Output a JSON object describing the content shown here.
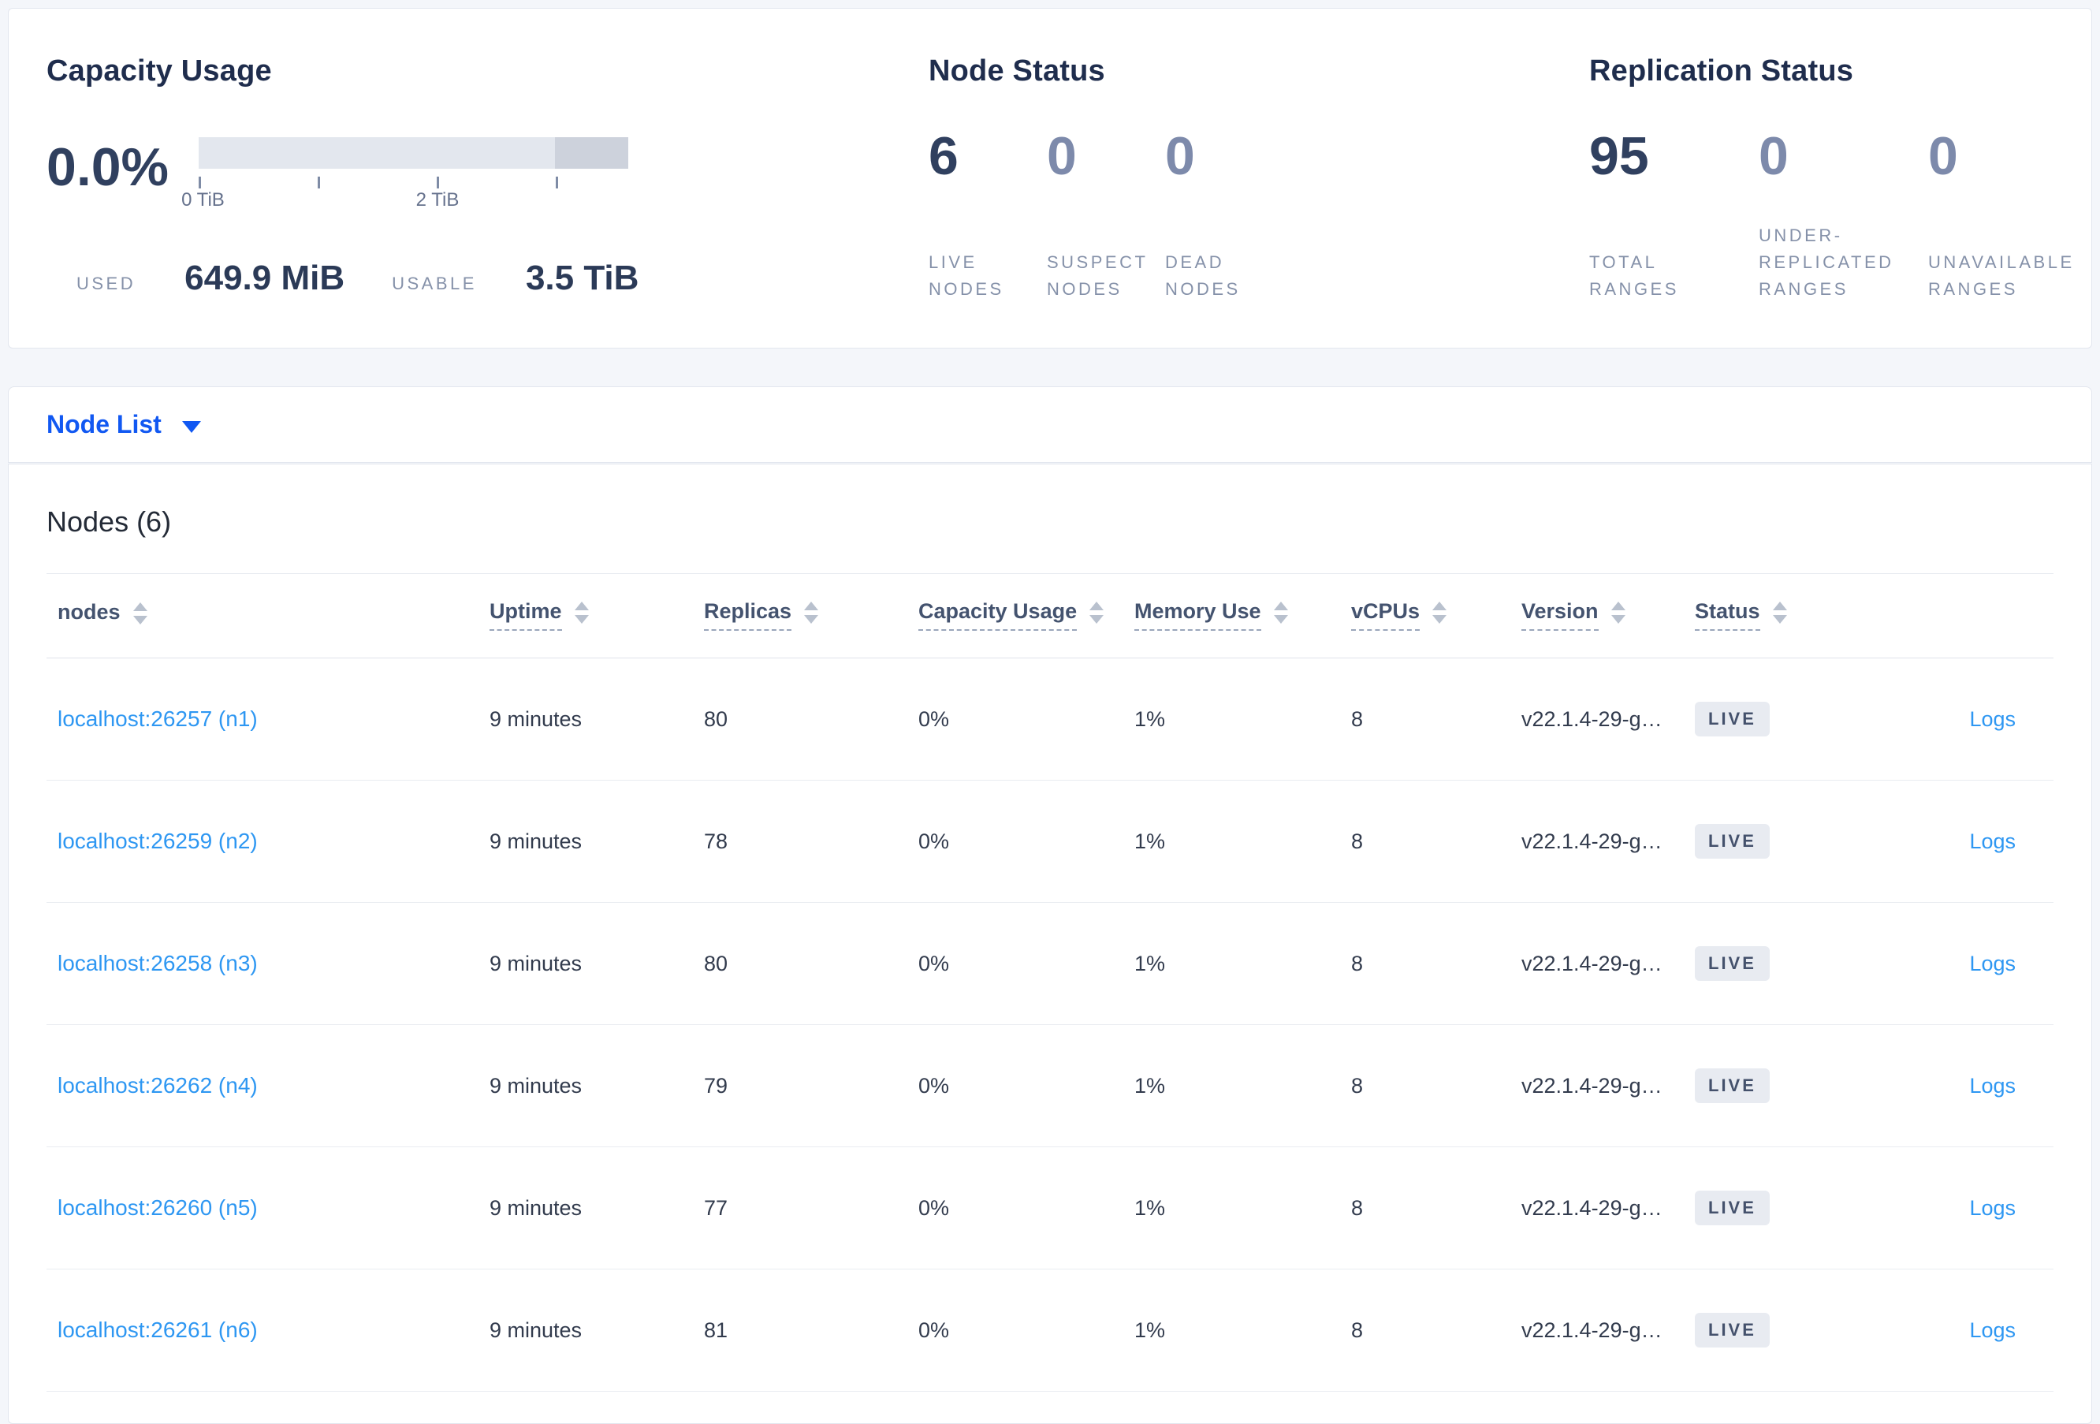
{
  "colors": {
    "accent_blue": "#1158f2",
    "link_blue": "#2e97f2",
    "page_background": "#f4f6fa",
    "badge_background": "#e8ebf1",
    "badge_text": "#44516c",
    "bar_light": "#e3e7ee",
    "bar_dark": "#cdd2dc"
  },
  "overview": {
    "capacity": {
      "title": "Capacity Usage",
      "percent": "0.0%",
      "tick_labels": [
        "0 TiB",
        "2 TiB"
      ],
      "used_label": "USED",
      "used_value": "649.9 MiB",
      "usable_label": "USABLE",
      "usable_value": "3.5 TiB"
    },
    "node_status": {
      "title": "Node Status",
      "stats": [
        {
          "value": "6",
          "label": "LIVE NODES"
        },
        {
          "value": "0",
          "label": "SUSPECT NODES"
        },
        {
          "value": "0",
          "label": "DEAD NODES"
        }
      ]
    },
    "replication": {
      "title": "Replication Status",
      "stats": [
        {
          "value": "95",
          "label": "TOTAL RANGES"
        },
        {
          "value": "0",
          "label": "UNDER-REPLICATED RANGES"
        },
        {
          "value": "0",
          "label": "UNAVAILABLE RANGES"
        }
      ]
    }
  },
  "view_selector": {
    "label": "Node List"
  },
  "nodes_section": {
    "title": "Nodes (6)",
    "columns": [
      {
        "label": "nodes"
      },
      {
        "label": "Uptime"
      },
      {
        "label": "Replicas"
      },
      {
        "label": "Capacity Usage"
      },
      {
        "label": "Memory Use"
      },
      {
        "label": "vCPUs"
      },
      {
        "label": "Version"
      },
      {
        "label": "Status"
      }
    ],
    "rows": [
      {
        "name": "localhost:26257 (n1)",
        "uptime": "9 minutes",
        "replicas": "80",
        "capacity": "0%",
        "memory": "1%",
        "vcpus": "8",
        "version": "v22.1.4-29-g…",
        "status": "LIVE",
        "logs": "Logs"
      },
      {
        "name": "localhost:26259 (n2)",
        "uptime": "9 minutes",
        "replicas": "78",
        "capacity": "0%",
        "memory": "1%",
        "vcpus": "8",
        "version": "v22.1.4-29-g…",
        "status": "LIVE",
        "logs": "Logs"
      },
      {
        "name": "localhost:26258 (n3)",
        "uptime": "9 minutes",
        "replicas": "80",
        "capacity": "0%",
        "memory": "1%",
        "vcpus": "8",
        "version": "v22.1.4-29-g…",
        "status": "LIVE",
        "logs": "Logs"
      },
      {
        "name": "localhost:26262 (n4)",
        "uptime": "9 minutes",
        "replicas": "79",
        "capacity": "0%",
        "memory": "1%",
        "vcpus": "8",
        "version": "v22.1.4-29-g…",
        "status": "LIVE",
        "logs": "Logs"
      },
      {
        "name": "localhost:26260 (n5)",
        "uptime": "9 minutes",
        "replicas": "77",
        "capacity": "0%",
        "memory": "1%",
        "vcpus": "8",
        "version": "v22.1.4-29-g…",
        "status": "LIVE",
        "logs": "Logs"
      },
      {
        "name": "localhost:26261 (n6)",
        "uptime": "9 minutes",
        "replicas": "81",
        "capacity": "0%",
        "memory": "1%",
        "vcpus": "8",
        "version": "v22.1.4-29-g…",
        "status": "LIVE",
        "logs": "Logs"
      }
    ]
  }
}
